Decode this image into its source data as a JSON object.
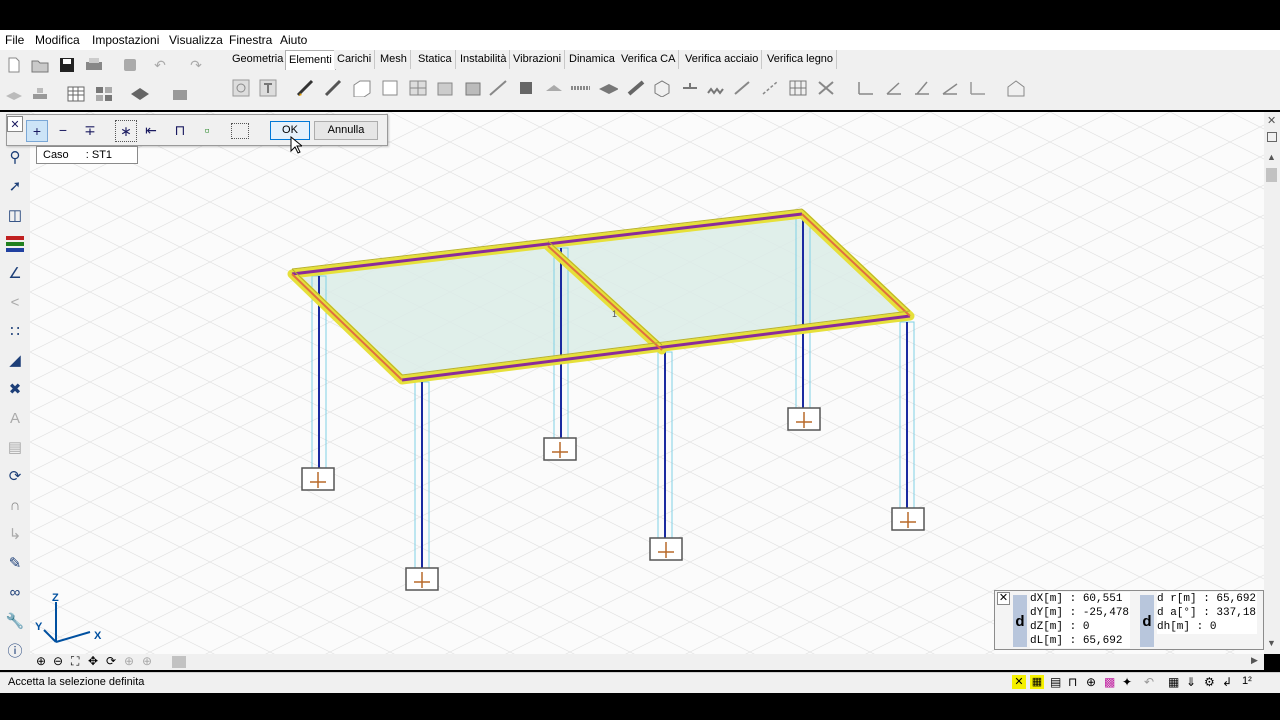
{
  "menu": [
    "File",
    "Modifica",
    "Impostazioni",
    "Visualizza",
    "Finestra",
    "Aiuto"
  ],
  "tabs": [
    "Geometria",
    "Elementi",
    "Carichi",
    "Mesh",
    "Statica",
    "Instabilità",
    "Vibrazioni",
    "Dinamica",
    "Verifica CA",
    "Verifica acciaio",
    "Verifica legno"
  ],
  "active_tab": "Elementi",
  "selection_bar": {
    "ok_label": "OK",
    "cancel_label": "Annulla"
  },
  "caso": {
    "label": "Caso",
    "value": ": ST1"
  },
  "model_label": "1",
  "axes": {
    "z": "Z",
    "y": "Y",
    "x": "X"
  },
  "measures_left": [
    {
      "k": "dX[m]",
      "v": ": 60,551"
    },
    {
      "k": "dY[m]",
      "v": ": -25,478"
    },
    {
      "k": "dZ[m]",
      "v": ": 0"
    },
    {
      "k": "dL[m]",
      "v": ": 65,692"
    }
  ],
  "measures_right": [
    {
      "k": "d r[m]",
      "v": ": 65,692"
    },
    {
      "k": "d a[°]",
      "v": ": 337,18"
    },
    {
      "k": "dh[m]",
      "v": ": 0"
    }
  ],
  "measure_symbol": "d",
  "status_text": "Accetta la selezione definita",
  "colors": {
    "beam_yellow": "#e6e03a",
    "beam_purple": "#8a2b9a",
    "column_blue": "#1a2aa0",
    "column_light": "#7fd0e6",
    "slab": "#d9ece6",
    "support": "#b86a2a"
  }
}
